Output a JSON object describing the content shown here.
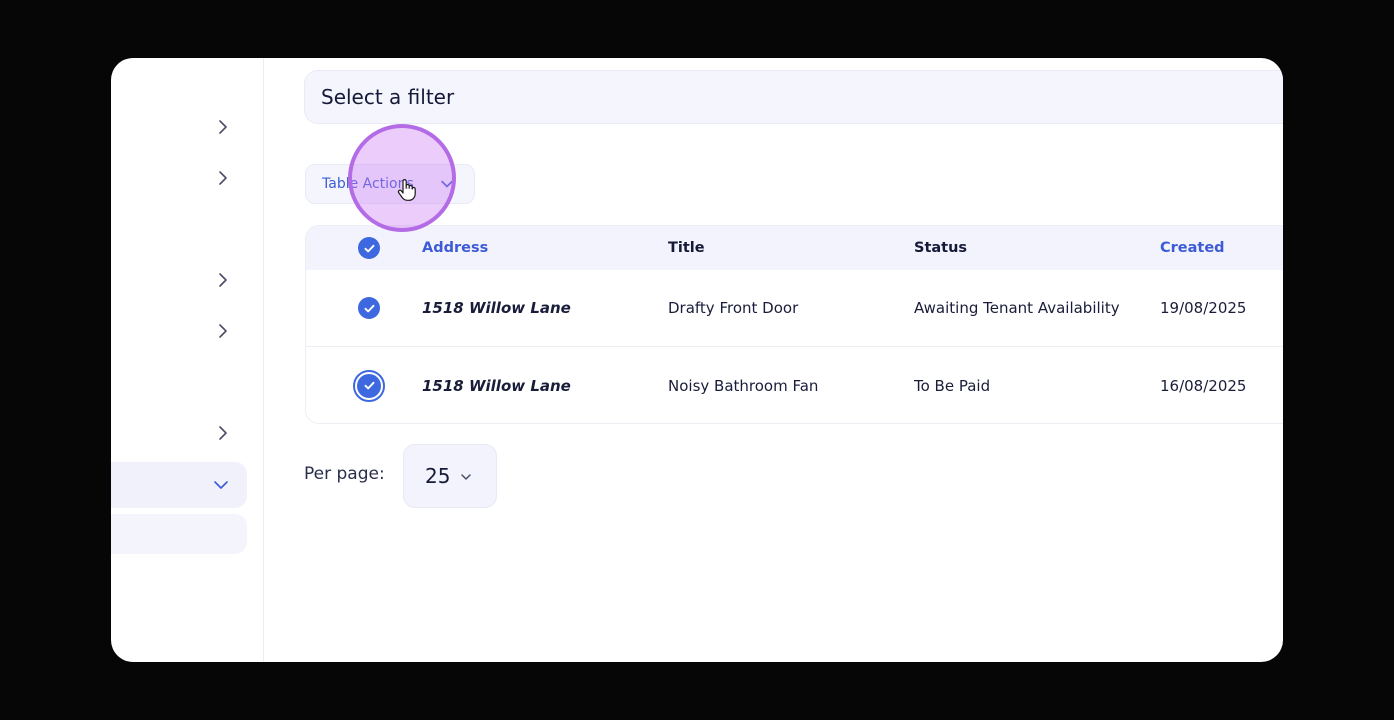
{
  "filter": {
    "placeholder": "Select a filter"
  },
  "table_actions": {
    "label": "Table Actions"
  },
  "table": {
    "columns": [
      "Address",
      "Title",
      "Status",
      "Created"
    ],
    "rows": [
      {
        "address": "1518 Willow Lane",
        "title": "Drafty Front Door",
        "status": "Awaiting Tenant Availability",
        "created": "19/08/2025"
      },
      {
        "address": "1518 Willow Lane",
        "title": "Noisy Bathroom Fan",
        "status": "To Be Paid",
        "created": "16/08/2025"
      }
    ]
  },
  "pagination": {
    "per_page_label": "Per page:",
    "per_page_value": "25"
  },
  "colors": {
    "accent": "#3d68e0",
    "link": "#3d5bd6",
    "click_highlight": "#b36be6"
  },
  "icons": [
    "chevron-right-icon",
    "chevron-down-icon",
    "check-circle-icon",
    "hand-pointer-icon"
  ]
}
